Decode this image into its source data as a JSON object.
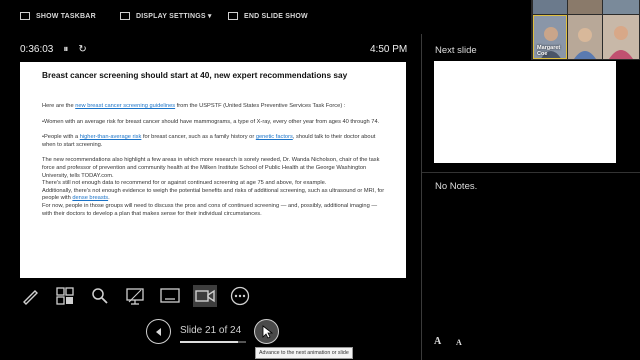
{
  "toolbar": {
    "show_taskbar": "SHOW TASKBAR",
    "display_settings": "DISPLAY SETTINGS ▾",
    "end_slide_show": "END SLIDE SHOW"
  },
  "presenter": {
    "timer": "0:36:03",
    "pause_glyph": "⏸",
    "restart_glyph": "↻",
    "clock": "4:50 PM"
  },
  "slide": {
    "title": "Breast cancer screening should start at 40, new expert recommendations say",
    "intro_pre": "Here are the ",
    "intro_link": "new breast cancer screening guidelines",
    "intro_post": " from the USPSTF (United States Preventive Services Task Force) :",
    "bullet1": "•Women with an average risk for breast cancer should have mammograms, a type of X-ray, every other year from ages 40 through 74.",
    "bullet2_pre": "•People with a ",
    "bullet2_link1": "higher-than-average risk",
    "bullet2_mid": " for breast cancer, such as a family history or ",
    "bullet2_link2": "genetic factors",
    "bullet2_post": ", should talk to their doctor about when to start screening.",
    "para1": "The new recommendations also highlight a few areas in which more research is sorely needed, Dr. Wanda Nicholson, chair of the task force and professor of prevention and community health at the Milken Institute School of Public Health at the George Washington University, tells TODAY.com.",
    "para2": "There's still not enough data to recommend for or against continued screening at age 75 and above, for example.",
    "para3_pre": "Additionally, there's not enough evidence to weigh the potential benefits and risks of additional screening, such as ultrasound or MRI, for people with ",
    "para3_link": "dense breasts",
    "para3_post": ".",
    "para4": "For now, people in those groups will need to discuss the pros and cons of continued screening — and, possibly, additional imaging — with their doctors to develop a plan that makes sense for their individual circumstances."
  },
  "navigation": {
    "slide_counter": "Slide 21 of 24",
    "progress_fraction": 0.875,
    "tooltip": "Advance to the next animation or slide"
  },
  "side_panel": {
    "next_slide_label": "Next slide",
    "notes_text": "No Notes.",
    "font_increase": "A",
    "font_decrease": "A"
  },
  "participants": {
    "margaret_label": "Margaret Coe"
  },
  "colors": {
    "link": "#1a73c8",
    "background": "#000000"
  }
}
